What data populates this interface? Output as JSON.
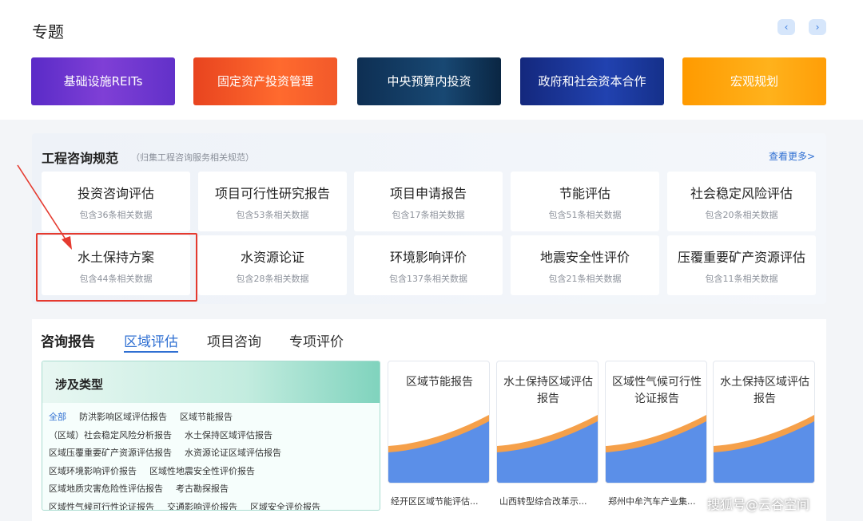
{
  "topic": {
    "title": "专题",
    "prev_icon": "‹",
    "next_icon": "›",
    "banners": [
      "基础设施REITs",
      "固定资产投资管理",
      "中央预算内投资",
      "政府和社会资本合作",
      "宏观规划"
    ]
  },
  "spec": {
    "title": "工程咨询规范",
    "subtitle": "（归集工程咨询服务相关规范）",
    "more": "查看更多>",
    "cards": [
      {
        "name": "投资咨询评估",
        "count": "包含36条相关数据"
      },
      {
        "name": "项目可行性研究报告",
        "count": "包含53条相关数据"
      },
      {
        "name": "项目申请报告",
        "count": "包含17条相关数据"
      },
      {
        "name": "节能评估",
        "count": "包含51条相关数据"
      },
      {
        "name": "社会稳定风险评估",
        "count": "包含20条相关数据"
      },
      {
        "name": "水土保持方案",
        "count": "包含44条相关数据"
      },
      {
        "name": "水资源论证",
        "count": "包含28条相关数据"
      },
      {
        "name": "环境影响评价",
        "count": "包含137条相关数据"
      },
      {
        "name": "地震安全性评价",
        "count": "包含21条相关数据"
      },
      {
        "name": "压覆重要矿产资源评估",
        "count": "包含11条相关数据"
      }
    ]
  },
  "report": {
    "tabs": [
      "咨询报告",
      "区域评估",
      "项目咨询",
      "专项评价"
    ],
    "types_title": "涉及类型",
    "types": [
      "全部",
      "防洪影响区域评估报告",
      "区域节能报告",
      "（区域）社会稳定风险分析报告",
      "水土保持区域评估报告",
      "区域压覆重要矿产资源评估报告",
      "水资源论证区域评估报告",
      "区域环境影响评价报告",
      "区域性地震安全性评价报告",
      "区域地质灾害危险性评估报告",
      "考古勘探报告",
      "区域性气候可行性论证报告",
      "交通影响评价报告",
      "区域安全评价报告"
    ],
    "cards": [
      {
        "title": "区域节能报告",
        "caption": "经开区区域节能评估..."
      },
      {
        "title": "水土保持区域评估报告",
        "caption": "山西转型综合改革示..."
      },
      {
        "title": "区域性气候可行性论证报告",
        "caption": "郑州中牟汽车产业集..."
      },
      {
        "title": "水土保持区域评估报告",
        "caption": ""
      }
    ]
  },
  "watermark": "搜狐号@云谷空间",
  "colors": {
    "accent": "#2f6fd2",
    "highlight": "#e53a2f"
  }
}
